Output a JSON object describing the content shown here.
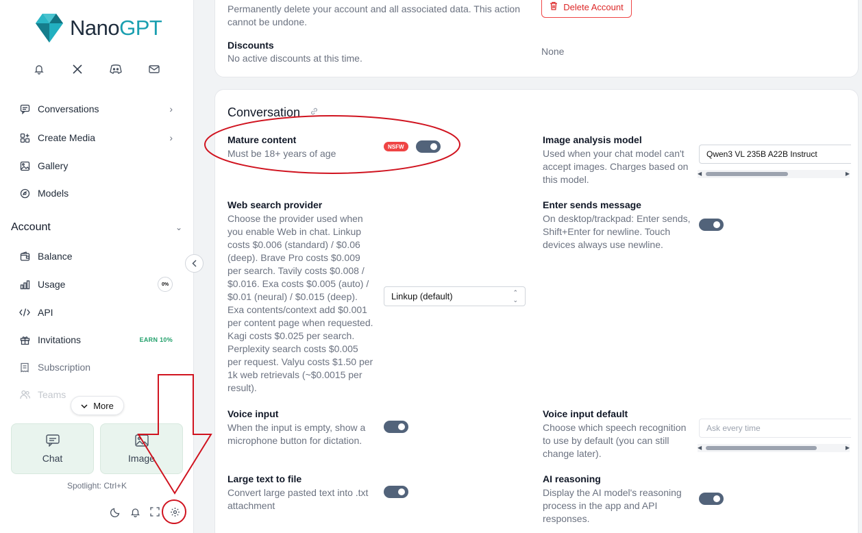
{
  "brand": {
    "name_part1": "Nano",
    "name_part2": "GPT"
  },
  "sidebar": {
    "social": [
      "bell-icon",
      "x-icon",
      "discord-icon",
      "mail-icon"
    ],
    "items": [
      {
        "label": "Conversations"
      },
      {
        "label": "Create Media"
      },
      {
        "label": "Gallery"
      },
      {
        "label": "Models"
      }
    ],
    "account_section": "Account",
    "account_items": [
      {
        "label": "Balance"
      },
      {
        "label": "Usage",
        "badge": "0%"
      },
      {
        "label": "API"
      },
      {
        "label": "Invitations",
        "badge": "EARN 10%"
      },
      {
        "label": "Subscription"
      },
      {
        "label": "Teams"
      }
    ],
    "more_label": "More",
    "cards": [
      {
        "label": "Chat"
      },
      {
        "label": "Image"
      }
    ],
    "spotlight": "Spotlight: Ctrl+K"
  },
  "account_panel": {
    "delete_desc": "Permanently delete your account and all associated data. This action cannot be undone.",
    "delete_button": "Delete Account",
    "discounts_label": "Discounts",
    "discounts_desc": "No active discounts at this time.",
    "discounts_value": "None"
  },
  "conversation": {
    "title": "Conversation",
    "mature": {
      "label": "Mature content",
      "desc": "Must be 18+ years of age",
      "badge": "NSFW",
      "on": true
    },
    "image_model": {
      "label": "Image analysis model",
      "desc": "Used when your chat model can't accept images. Charges based on this model.",
      "value": "Qwen3 VL 235B A22B Instruct"
    },
    "web_search": {
      "label": "Web search provider",
      "desc": "Choose the provider used when you enable Web in chat. Linkup costs $0.006 (standard) / $0.06 (deep). Brave Pro costs $0.009 per search. Tavily costs $0.008 / $0.016. Exa costs $0.005 (auto) / $0.01 (neural) / $0.015 (deep). Exa contents/context add $0.001 per content page when requested. Kagi costs $0.025 per search. Perplexity search costs $0.005 per request. Valyu costs $1.50 per 1k web retrievals (~$0.0015 per result).",
      "value": "Linkup (default)"
    },
    "enter_sends": {
      "label": "Enter sends message",
      "desc": "On desktop/trackpad: Enter sends, Shift+Enter for newline. Touch devices always use newline.",
      "on": true
    },
    "voice_input": {
      "label": "Voice input",
      "desc": "When the input is empty, show a microphone button for dictation.",
      "on": true
    },
    "voice_default": {
      "label": "Voice input default",
      "desc": "Choose which speech recognition to use by default (you can still change later).",
      "placeholder": "Ask every time"
    },
    "large_text": {
      "label": "Large text to file",
      "desc": "Convert large pasted text into .txt attachment",
      "on": true
    },
    "ai_reasoning": {
      "label": "AI reasoning",
      "desc": "Display the AI model's reasoning process in the app and API responses.",
      "on": true
    }
  },
  "colors": {
    "accent": "#52637a",
    "danger": "#ef4444",
    "annotation": "#d0131f",
    "brand": "#1a9fb0"
  }
}
